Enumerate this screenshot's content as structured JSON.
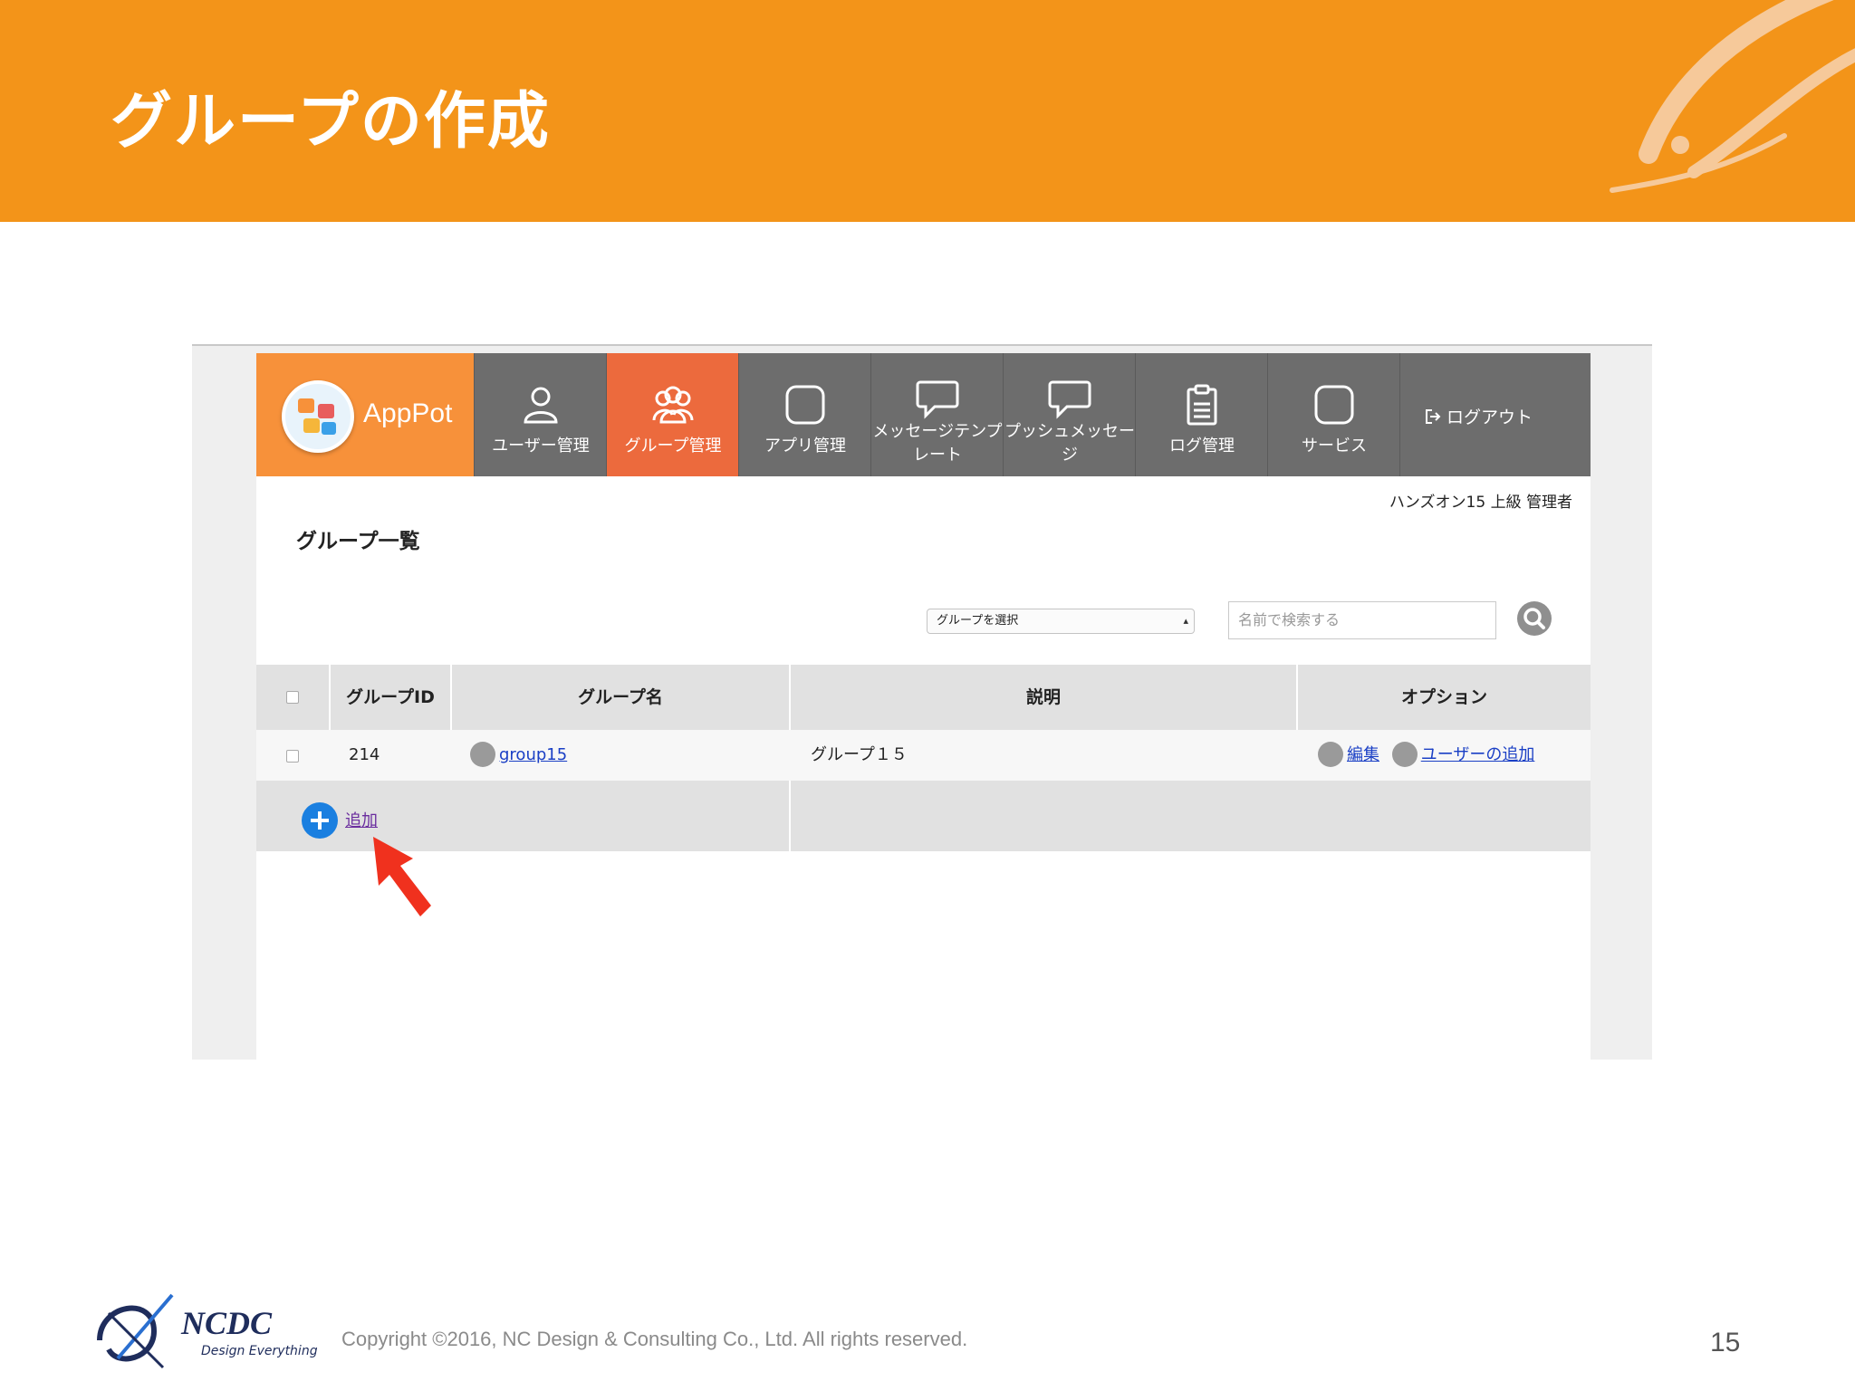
{
  "slide": {
    "title": "グループの作成",
    "copyright": "Copyright ©2016, NC Design & Consulting Co., Ltd. All rights reserved.",
    "page_number": "15",
    "company_name": "NCDC",
    "company_tagline": "Design Everything",
    "accent_color": "#f39419"
  },
  "app": {
    "brand": "AppPot",
    "nav": [
      {
        "label": "ユーザー管理",
        "icon": "user-icon"
      },
      {
        "label": "グループ管理",
        "icon": "group-icon",
        "active": true
      },
      {
        "label": "アプリ管理",
        "icon": "app-icon"
      },
      {
        "label_line1": "メッセージテンプ",
        "label_line2": "レート",
        "icon": "speech-bubble-icon"
      },
      {
        "label_line1": "プッシュメッセー",
        "label_line2": "ジ",
        "icon": "speech-bubble-icon"
      },
      {
        "label": "ログ管理",
        "icon": "clipboard-icon"
      },
      {
        "label": "サービス",
        "icon": "service-icon"
      }
    ],
    "logout_label": "ログアウト",
    "user_line": "ハンズオン15 上級 管理者",
    "page_heading": "グループ一覧",
    "group_select": "グループを選択",
    "search_placeholder": "名前で検索する",
    "table": {
      "headers": {
        "id": "グループID",
        "name": "グループ名",
        "description": "説明",
        "options": "オプション"
      },
      "rows": [
        {
          "id": "214",
          "name": "group15",
          "description": "グループ１５",
          "edit": "編集",
          "add_user": "ユーザーの追加"
        }
      ],
      "add_label": "追加"
    },
    "highlight_color": "#ec6a3d",
    "callout_arrow_color": "#f0311e"
  }
}
